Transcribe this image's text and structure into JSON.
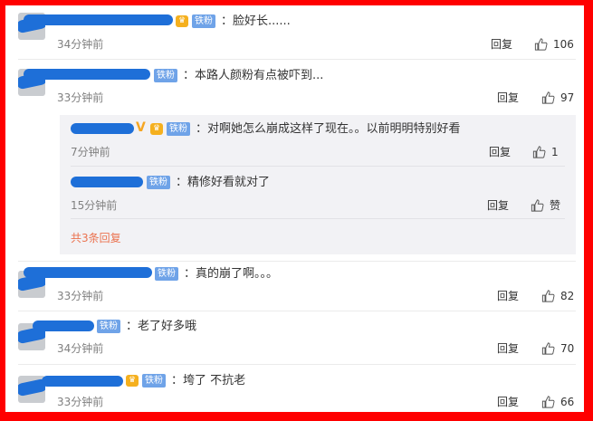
{
  "badge_label": "铁粉",
  "reply_label": "回复",
  "comments": [
    {
      "text": "：脸好长......",
      "time": "34分钟前",
      "likes": "106"
    },
    {
      "text": "：本路人颜粉有点被吓到...",
      "time": "33分钟前",
      "likes": "97"
    },
    {
      "text": "：真的崩了啊。。。",
      "time": "33分钟前",
      "likes": "82"
    },
    {
      "text": "：老了好多哦",
      "time": "34分钟前",
      "likes": "70"
    },
    {
      "text": "：垮了 不抗老",
      "time": "33分钟前",
      "likes": "66"
    }
  ],
  "sub_replies": [
    {
      "text": "：对啊她怎么崩成这样了现在。。以前明明特别好看",
      "time": "7分钟前",
      "likes": "1"
    },
    {
      "text": "：精修好看就对了",
      "time": "15分钟前",
      "likes": "赞"
    }
  ],
  "more_replies": "共3条回复",
  "colors": {
    "frame": "#ff0000",
    "badge": "#6fa3e8",
    "more_link": "#eb7350",
    "redaction": "#1e6fd8"
  },
  "icons": {
    "like": "thumbs-up-icon",
    "vip": "vip-crown-icon"
  }
}
